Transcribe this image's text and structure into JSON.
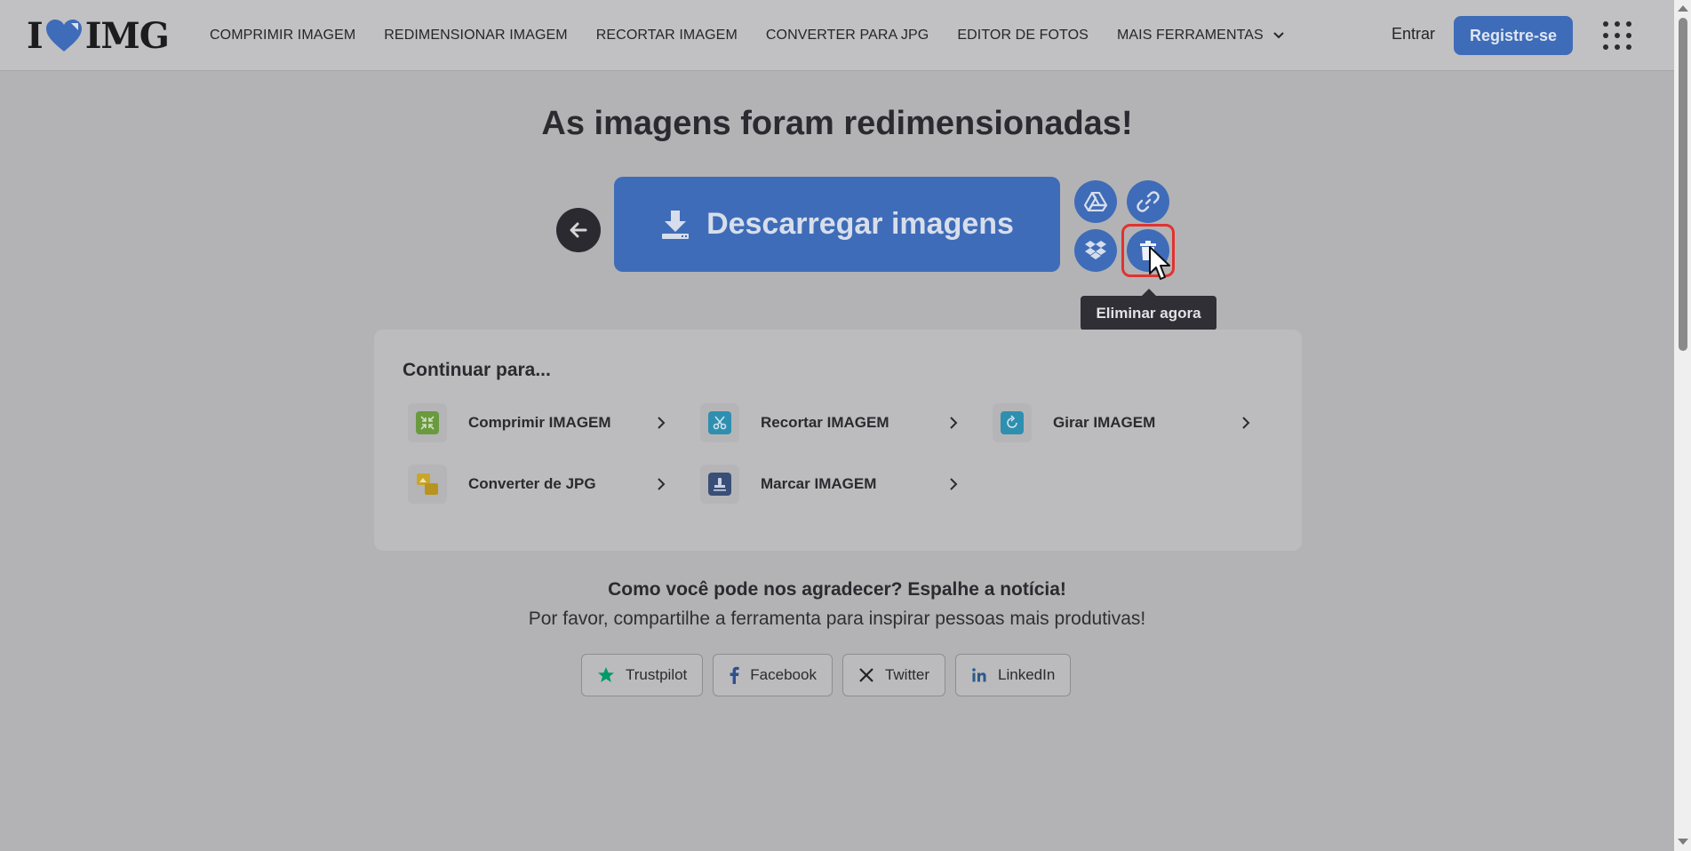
{
  "header": {
    "logo_left": "I",
    "logo_right": "IMG",
    "nav": [
      {
        "label": "COMPRIMIR IMAGEM"
      },
      {
        "label": "REDIMENSIONAR IMAGEM"
      },
      {
        "label": "RECORTAR IMAGEM"
      },
      {
        "label": "CONVERTER PARA JPG"
      },
      {
        "label": "EDITOR DE FOTOS"
      },
      {
        "label": "MAIS FERRAMENTAS"
      }
    ],
    "login_label": "Entrar",
    "signup_label": "Registre-se"
  },
  "main": {
    "title": "As imagens foram redimensionadas!",
    "download_label": "Descarregar imagens",
    "tooltip": "Eliminar agora",
    "icons": {
      "back": "arrow-left-icon",
      "drive": "google-drive-icon",
      "link": "link-icon",
      "dropbox": "dropbox-icon",
      "delete": "trash-icon"
    }
  },
  "continue": {
    "title": "Continuar para...",
    "tools": [
      {
        "label": "Comprimir IMAGEM",
        "icon": "compress-icon",
        "color": "#6a9a3e"
      },
      {
        "label": "Recortar IMAGEM",
        "icon": "scissors-icon",
        "color": "#2f8fb0"
      },
      {
        "label": "Girar IMAGEM",
        "icon": "rotate-icon",
        "color": "#2f8fb0"
      },
      {
        "label": "Converter de JPG",
        "icon": "convert-icon",
        "color": "#c9a52a"
      },
      {
        "label": "Marcar IMAGEM",
        "icon": "stamp-icon",
        "color": "#3a4f78"
      }
    ]
  },
  "share": {
    "heading": "Como você pode nos agradecer? Espalhe a notícia!",
    "subheading": "Por favor, compartilhe a ferramenta para inspirar pessoas mais produtivas!",
    "buttons": [
      {
        "label": "Trustpilot",
        "icon": "star-icon",
        "color": "#00996a"
      },
      {
        "label": "Facebook",
        "icon": "facebook-icon",
        "color": "#2f4f8f"
      },
      {
        "label": "Twitter",
        "icon": "x-icon",
        "color": "#222226"
      },
      {
        "label": "LinkedIn",
        "icon": "linkedin-icon",
        "color": "#2b5a8c"
      }
    ]
  },
  "colors": {
    "accent": "#3f6cb8",
    "highlight": "#e2322f"
  }
}
